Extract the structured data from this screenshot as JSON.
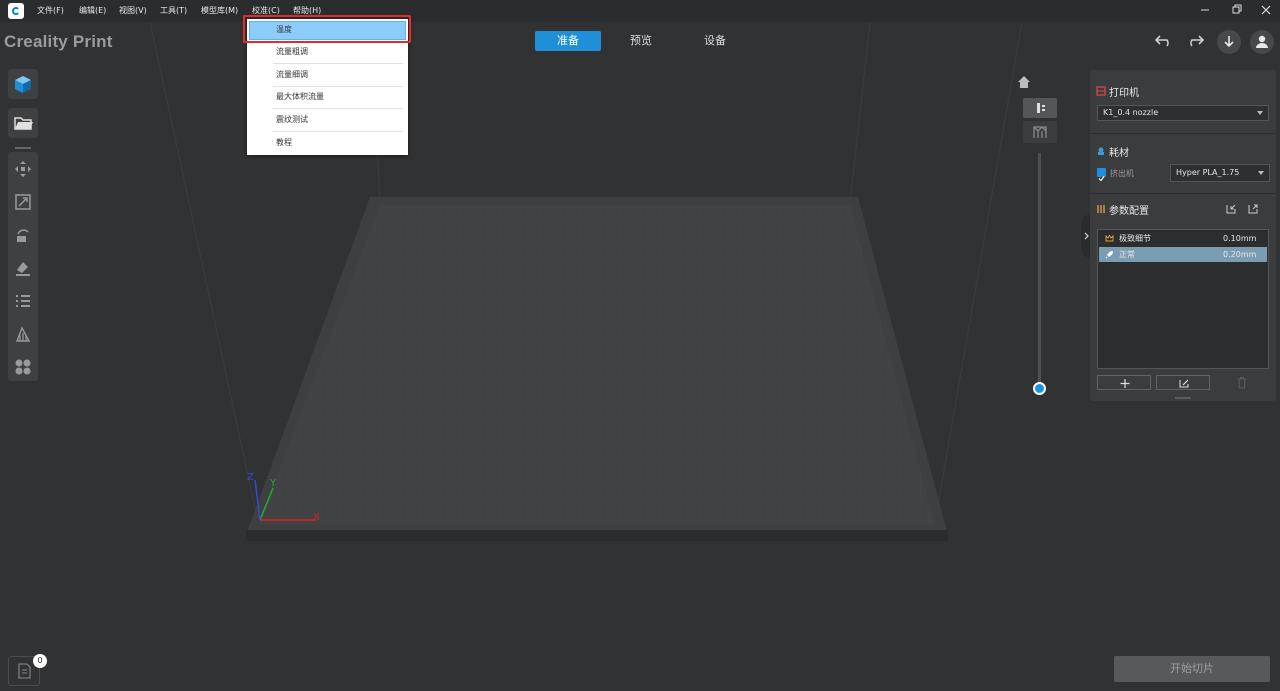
{
  "menubar": {
    "items": [
      "文件(F)",
      "编辑(E)",
      "视图(V)",
      "工具(T)",
      "模型库(M)",
      "校准(C)",
      "帮助(H)"
    ]
  },
  "brand": "Creality Print",
  "tabs": [
    {
      "label": "准备",
      "active": true
    },
    {
      "label": "预览",
      "active": false
    },
    {
      "label": "设备",
      "active": false
    }
  ],
  "calibration_menu": {
    "items": [
      "温度",
      "流量粗调",
      "流量细调",
      "最大体积流量",
      "震纹测试",
      "教程"
    ],
    "highlighted": "温度"
  },
  "right_panel": {
    "printer": {
      "title": "打印机",
      "selected": "K1_0.4 nozzle"
    },
    "filament": {
      "title": "耗材",
      "extruder_label": "挤出机",
      "selected": "Hyper PLA_1.75"
    },
    "params": {
      "title": "参数配置",
      "profiles": [
        {
          "name": "极致细节",
          "layer": "0.10mm",
          "selected": false
        },
        {
          "name": "正常",
          "layer": "0.20mm",
          "selected": true
        }
      ]
    }
  },
  "axes": {
    "x": "X",
    "y": "Y",
    "z": "Z"
  },
  "bottom": {
    "slice_button": "开始切片",
    "file_count": "0"
  },
  "colors": {
    "accent": "#1e8fd8",
    "highlight": "#8bcdf8",
    "annotation": "#e22b2b",
    "x_axis": "#e02020",
    "y_axis": "#22b026",
    "z_axis": "#3a46d8"
  }
}
